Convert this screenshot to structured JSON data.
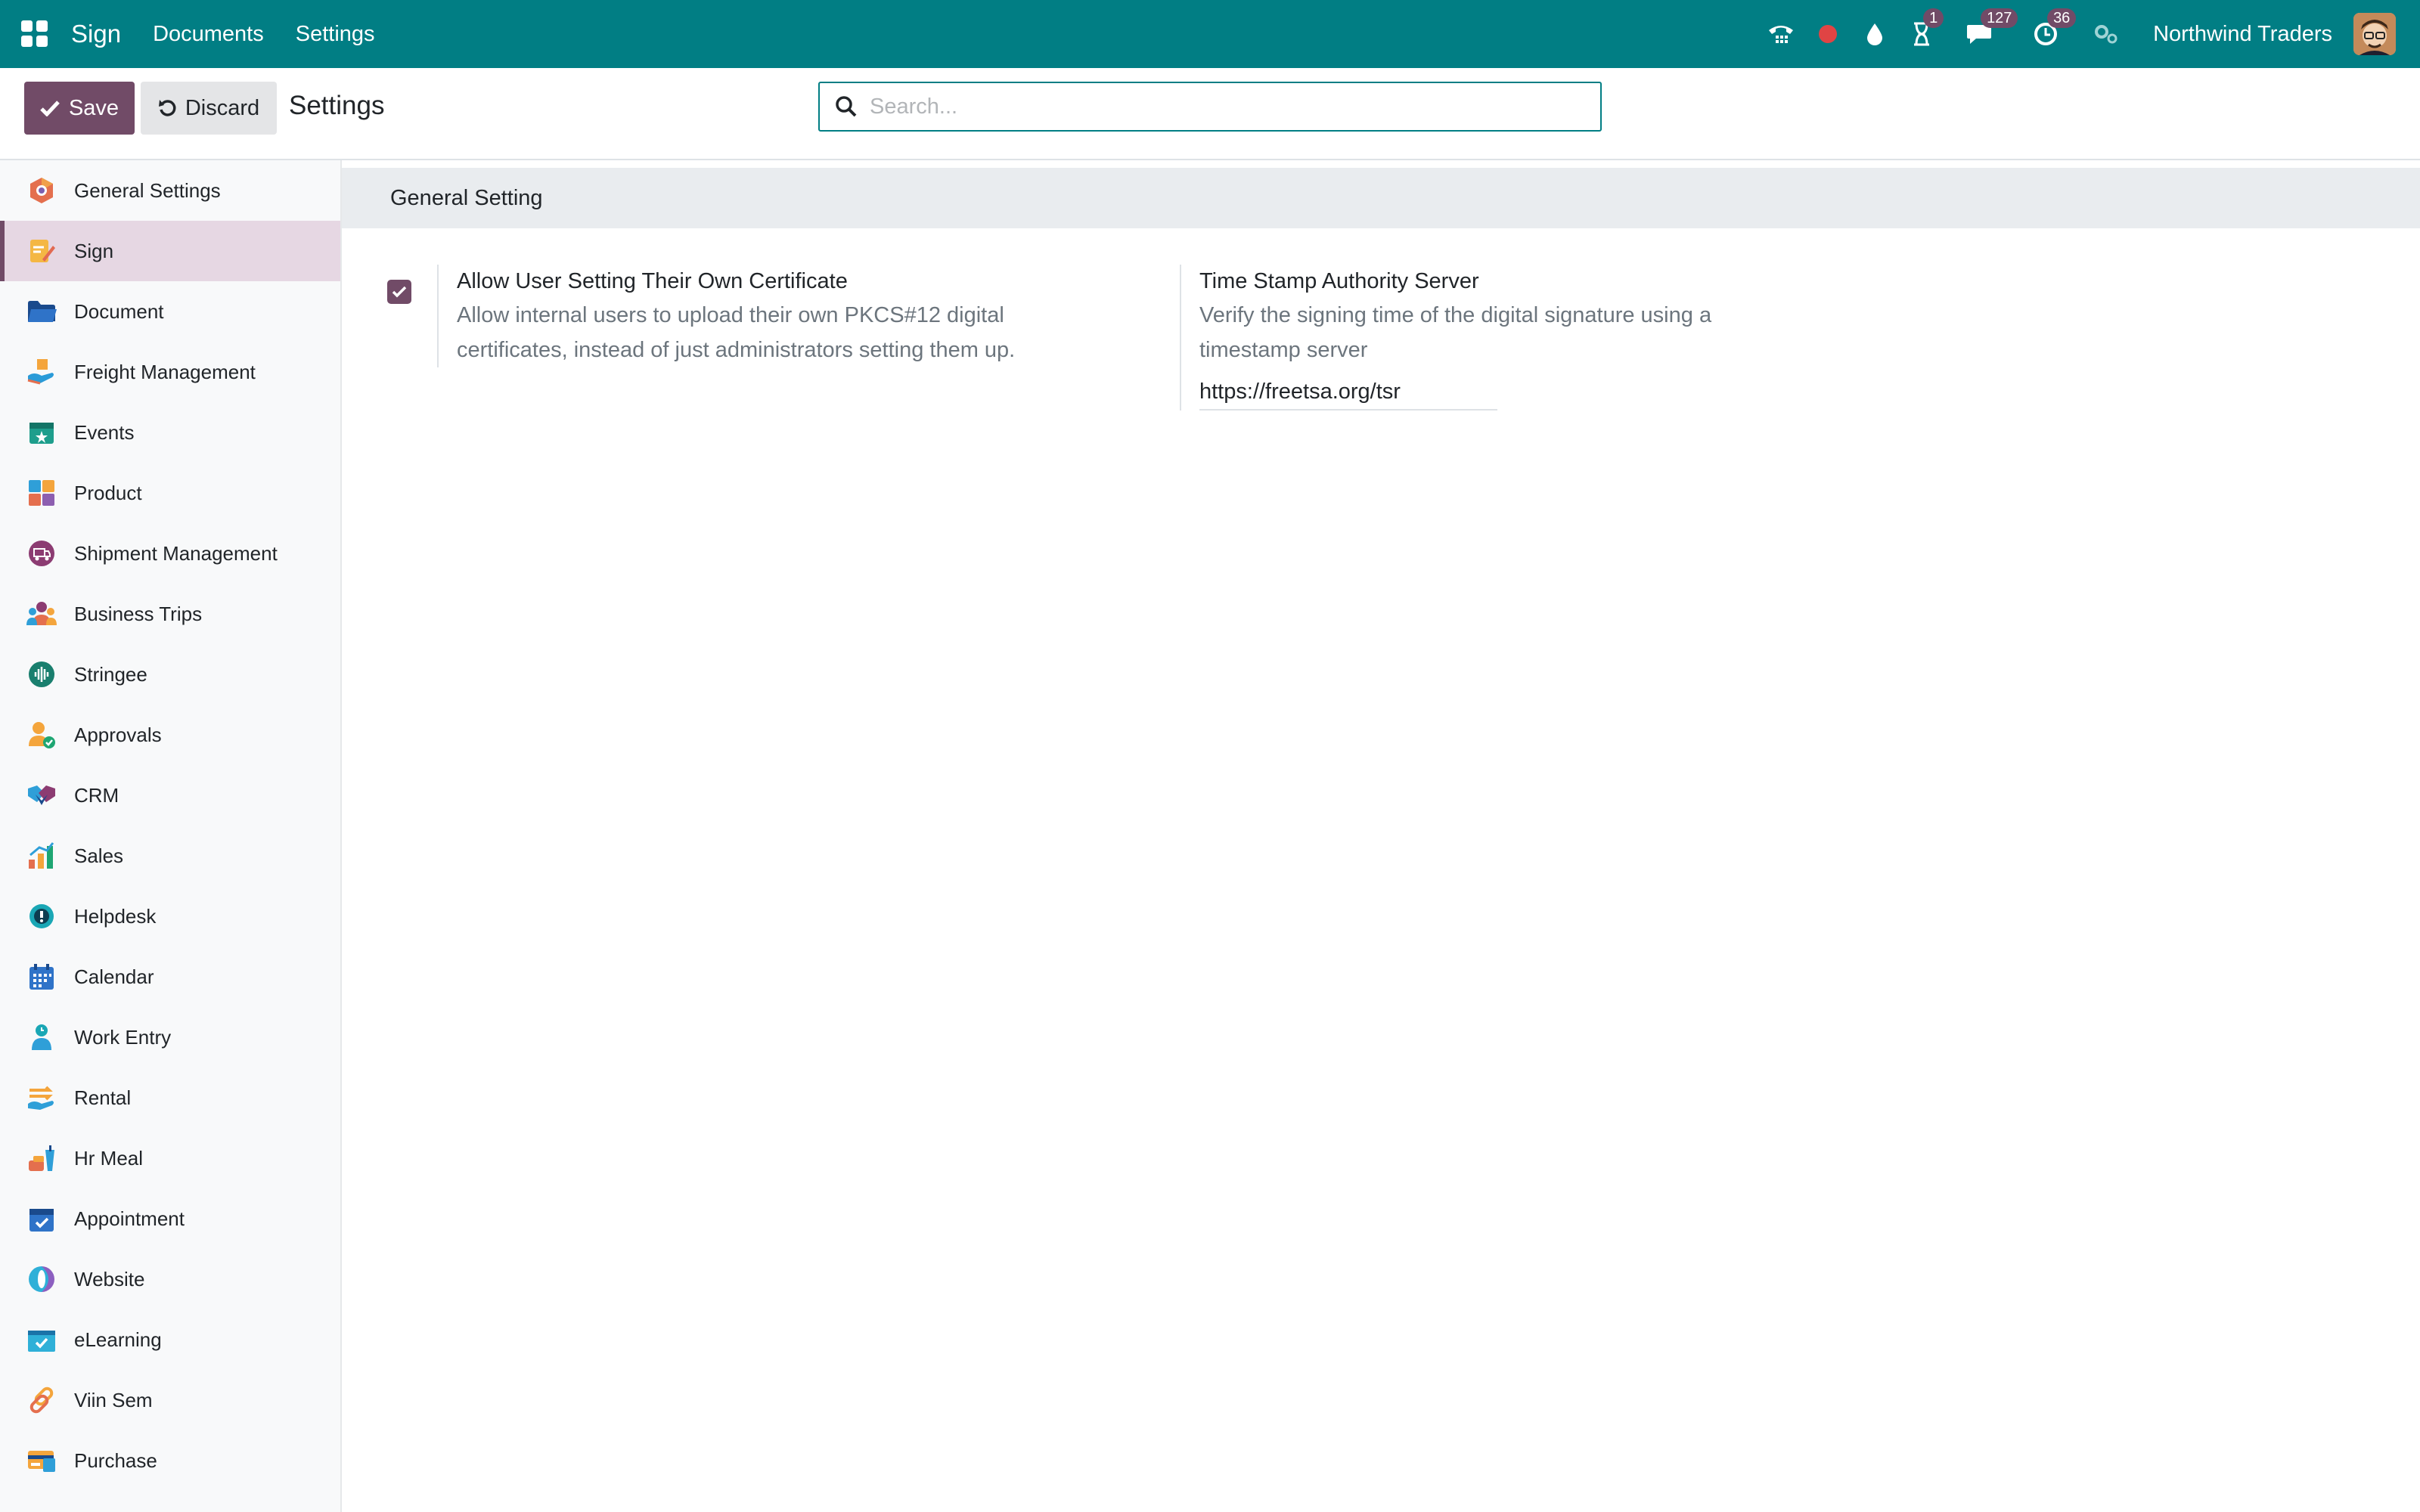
{
  "navbar": {
    "brand": "Sign",
    "menu": [
      "Documents",
      "Settings"
    ],
    "badges": {
      "activities": "1",
      "messages": "127",
      "timer": "36"
    },
    "company": "Northwind Traders",
    "color": "#017e84"
  },
  "control": {
    "save_label": "Save",
    "discard_label": "Discard",
    "title": "Settings",
    "search_placeholder": "Search..."
  },
  "sidebar": {
    "items": [
      {
        "label": "General Settings",
        "icon": "settings-hex-icon"
      },
      {
        "label": "Sign",
        "icon": "sign-icon",
        "active": true
      },
      {
        "label": "Document",
        "icon": "folder-icon"
      },
      {
        "label": "Freight Management",
        "icon": "freight-icon"
      },
      {
        "label": "Events",
        "icon": "events-icon"
      },
      {
        "label": "Product",
        "icon": "product-icon"
      },
      {
        "label": "Shipment Management",
        "icon": "shipment-icon"
      },
      {
        "label": "Business Trips",
        "icon": "business-trips-icon"
      },
      {
        "label": "Stringee",
        "icon": "stringee-icon"
      },
      {
        "label": "Approvals",
        "icon": "approvals-icon"
      },
      {
        "label": "CRM",
        "icon": "crm-icon"
      },
      {
        "label": "Sales",
        "icon": "sales-icon"
      },
      {
        "label": "Helpdesk",
        "icon": "helpdesk-icon"
      },
      {
        "label": "Calendar",
        "icon": "calendar-icon"
      },
      {
        "label": "Work Entry",
        "icon": "work-entry-icon"
      },
      {
        "label": "Rental",
        "icon": "rental-icon"
      },
      {
        "label": "Hr Meal",
        "icon": "hr-meal-icon"
      },
      {
        "label": "Appointment",
        "icon": "appointment-icon"
      },
      {
        "label": "Website",
        "icon": "website-icon"
      },
      {
        "label": "eLearning",
        "icon": "elearning-icon"
      },
      {
        "label": "Viin Sem",
        "icon": "viin-sem-icon"
      },
      {
        "label": "Purchase",
        "icon": "purchase-icon"
      }
    ]
  },
  "main": {
    "section_title": "General Setting",
    "own_certificate": {
      "title": "Allow User Setting Their Own Certificate",
      "desc_line1": "Allow internal users to upload their own PKCS#12 digital",
      "desc_line2": "certificates, instead of just administrators setting them up.",
      "checked": true
    },
    "tsa": {
      "title": "Time Stamp Authority Server",
      "desc_line1": "Verify the signing time of the digital signature using a",
      "desc_line2": "timestamp server",
      "value": "https://freetsa.org/tsr"
    }
  }
}
